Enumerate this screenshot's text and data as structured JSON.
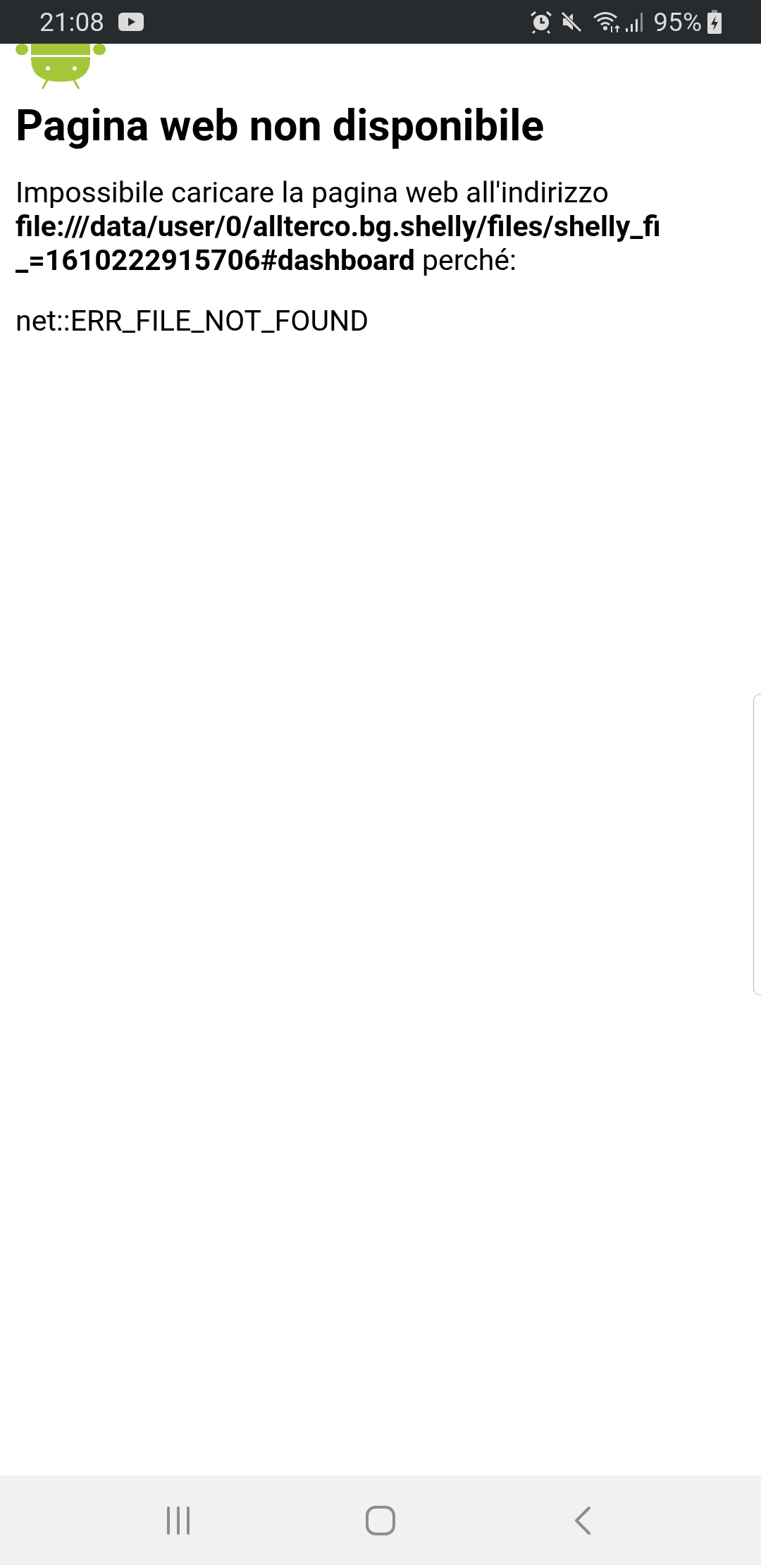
{
  "status_bar": {
    "time": "21:08",
    "battery": "95%"
  },
  "page": {
    "title": "Pagina web non disponibile",
    "message": "Impossibile caricare la pagina web all'indirizzo\n**file:///data/user/0/allterco.bg.shelly/files/shelly_fi**\n**_=1610222915706#dashboard** perché:",
    "error": "net::ERR_FILE_NOT_FOUND"
  }
}
